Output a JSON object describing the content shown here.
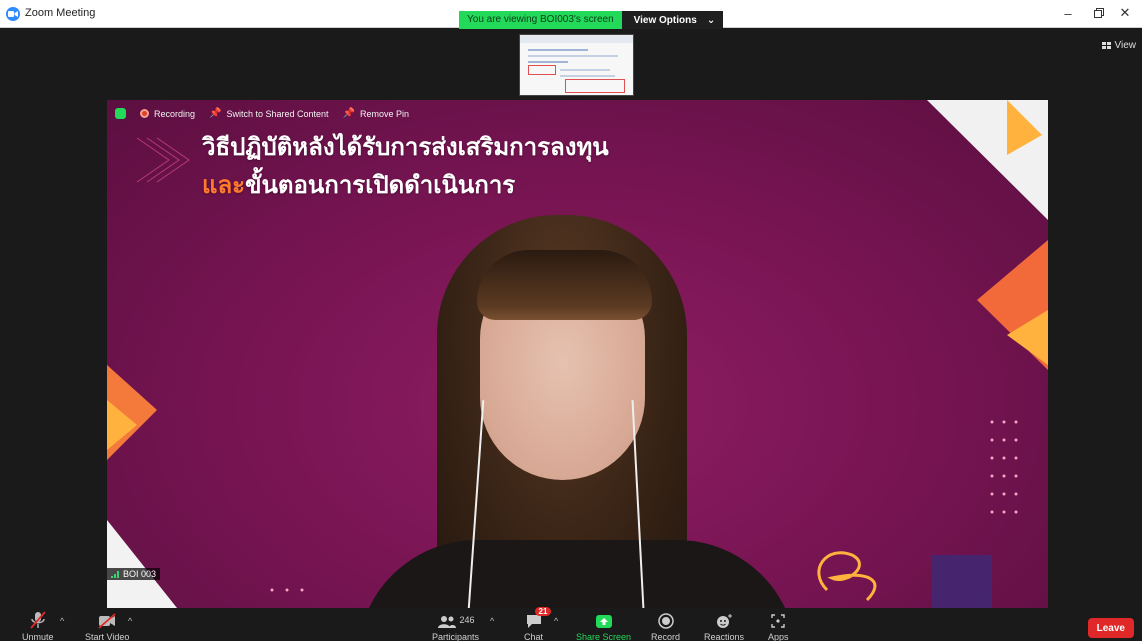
{
  "window": {
    "title": "Zoom Meeting"
  },
  "banner": {
    "text": "You are viewing BOI003's screen",
    "options_label": "View Options"
  },
  "view_button": "View",
  "overlay": {
    "recording": "Recording",
    "switch": "Switch to Shared Content",
    "remove_pin": "Remove Pin"
  },
  "slide": {
    "line1": "วิธีปฏิบัติหลังได้รับการส่งเสริมการลงทุน",
    "line2_hl": "และ",
    "line2_rest": "ขั้นตอนการเปิดดำเนินการ"
  },
  "participant_name": "BOI 003",
  "toolbar": {
    "unmute": "Unmute",
    "start_video": "Start Video",
    "participants": "Participants",
    "participants_count": "246",
    "chat": "Chat",
    "chat_badge": "21",
    "share_screen": "Share Screen",
    "record": "Record",
    "reactions": "Reactions",
    "apps": "Apps",
    "leave": "Leave"
  },
  "colors": {
    "accent": "#2D8CFF",
    "green": "#23D959",
    "leave": "#E02828",
    "slide_bg": "#7A1554"
  }
}
